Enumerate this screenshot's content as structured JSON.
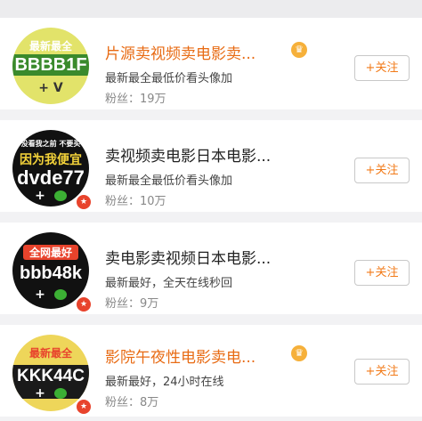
{
  "users": [
    {
      "name": "片源卖视频卖电影卖...",
      "description": "最新最全最低价看头像加",
      "fans": "粉丝：19万",
      "follow_label": "+关注",
      "avatar_top": "最新最全",
      "avatar_main": "BBBB1F",
      "avatar_bottom": "+ V",
      "name_color": "#e86b14"
    },
    {
      "name": "卖视频卖电影日本电影...",
      "description": "最新最全最低价看头像加",
      "fans": "粉丝：10万",
      "follow_label": "+关注",
      "avatar_top": "没看我之前 不要买",
      "avatar_mid": "因为我便宜",
      "avatar_main": "dvde77",
      "avatar_bottom": "+",
      "name_color": "#222222"
    },
    {
      "name": "卖电影卖视频日本电影...",
      "description": "最新最好，全天在线秒回",
      "fans": "粉丝：9万",
      "follow_label": "+关注",
      "avatar_top": "全网最好",
      "avatar_main": "bbb48k",
      "avatar_bottom": "+",
      "name_color": "#222222"
    },
    {
      "name": "影院午夜性电影卖电...",
      "description": "最新最好，24小时在线",
      "fans": "粉丝：8万",
      "follow_label": "+关注",
      "avatar_top": "最新最全",
      "avatar_main": "KKK44C",
      "avatar_bottom": "+",
      "name_color": "#e86b14"
    }
  ],
  "colors": {
    "accent": "#f27a18",
    "vip_name": "#e86b14",
    "badge": "#e8432c",
    "crown": "#f6b03a"
  },
  "icons": {
    "crown": "crown-icon",
    "badge": "verified-badge-icon",
    "wechat": "wechat-icon"
  }
}
